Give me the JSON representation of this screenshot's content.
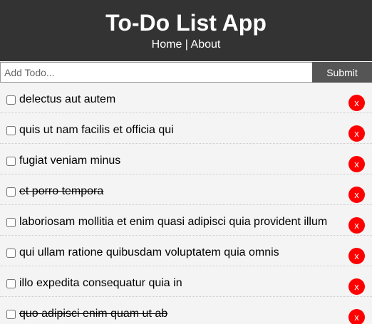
{
  "header": {
    "title": "To-Do List App",
    "nav": {
      "home": "Home",
      "separator": " | ",
      "about": "About"
    }
  },
  "add_form": {
    "placeholder": "Add Todo...",
    "submit_label": "Submit"
  },
  "todos": [
    {
      "title": "delectus aut autem",
      "completed": false,
      "delete_label": "x"
    },
    {
      "title": "quis ut nam facilis et officia qui",
      "completed": false,
      "delete_label": "x"
    },
    {
      "title": "fugiat veniam minus",
      "completed": false,
      "delete_label": "x"
    },
    {
      "title": "et porro tempora",
      "completed": true,
      "delete_label": "x"
    },
    {
      "title": "laboriosam mollitia et enim quasi adipisci quia provident illum",
      "completed": false,
      "delete_label": "x"
    },
    {
      "title": "qui ullam ratione quibusdam voluptatem quia omnis",
      "completed": false,
      "delete_label": "x"
    },
    {
      "title": "illo expedita consequatur quia in",
      "completed": false,
      "delete_label": "x"
    },
    {
      "title": "quo adipisci enim quam ut ab",
      "completed": true,
      "delete_label": "x"
    }
  ],
  "colors": {
    "header_bg": "#333333",
    "submit_bg": "#555555",
    "item_bg": "#f4f4f4",
    "delete_bg": "#ff0000"
  }
}
